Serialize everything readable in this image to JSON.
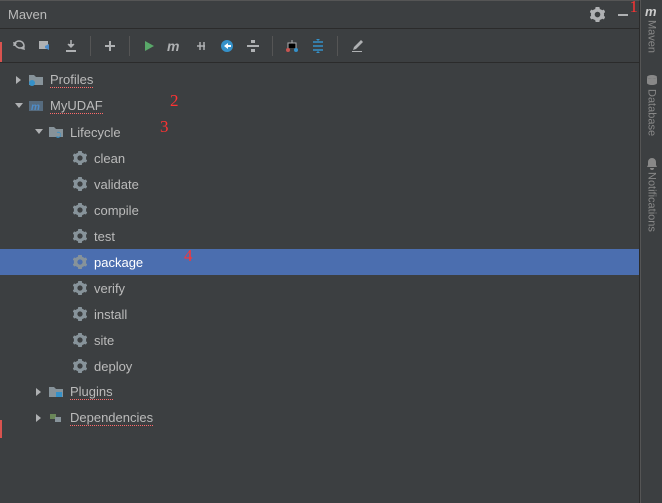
{
  "header": {
    "title": "Maven"
  },
  "tree": {
    "profiles": "Profiles",
    "project": "MyUDAF",
    "lifecycle": "Lifecycle",
    "goals": [
      "clean",
      "validate",
      "compile",
      "test",
      "package",
      "verify",
      "install",
      "site",
      "deploy"
    ],
    "selected_goal_index": 4,
    "plugins": "Plugins",
    "dependencies": "Dependencies"
  },
  "annotations": {
    "a1": "1",
    "a2": "2",
    "a3": "3",
    "a4": "4"
  },
  "sidebar": {
    "maven": "Maven",
    "database": "Database",
    "notifications": "Notifications"
  }
}
